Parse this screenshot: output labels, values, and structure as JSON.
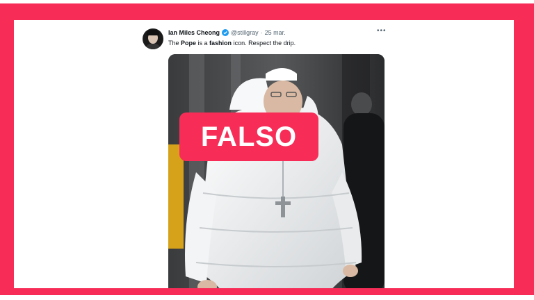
{
  "tweet": {
    "author_name": "Ian Miles Cheong",
    "handle": "@stillgray",
    "separator": "·",
    "date": "25 mar.",
    "more_icon": "more-dots-icon",
    "verified_icon": "verified-badge-icon",
    "text_parts": [
      "The ",
      "Pope",
      " is a ",
      "fashion",
      " icon. Respect the drip."
    ]
  },
  "overlay": {
    "label": "FALSO",
    "color": "#f72d57"
  },
  "colors": {
    "frame": "#f72d57",
    "verified": "#1d9bf0",
    "muted_text": "#536471"
  }
}
